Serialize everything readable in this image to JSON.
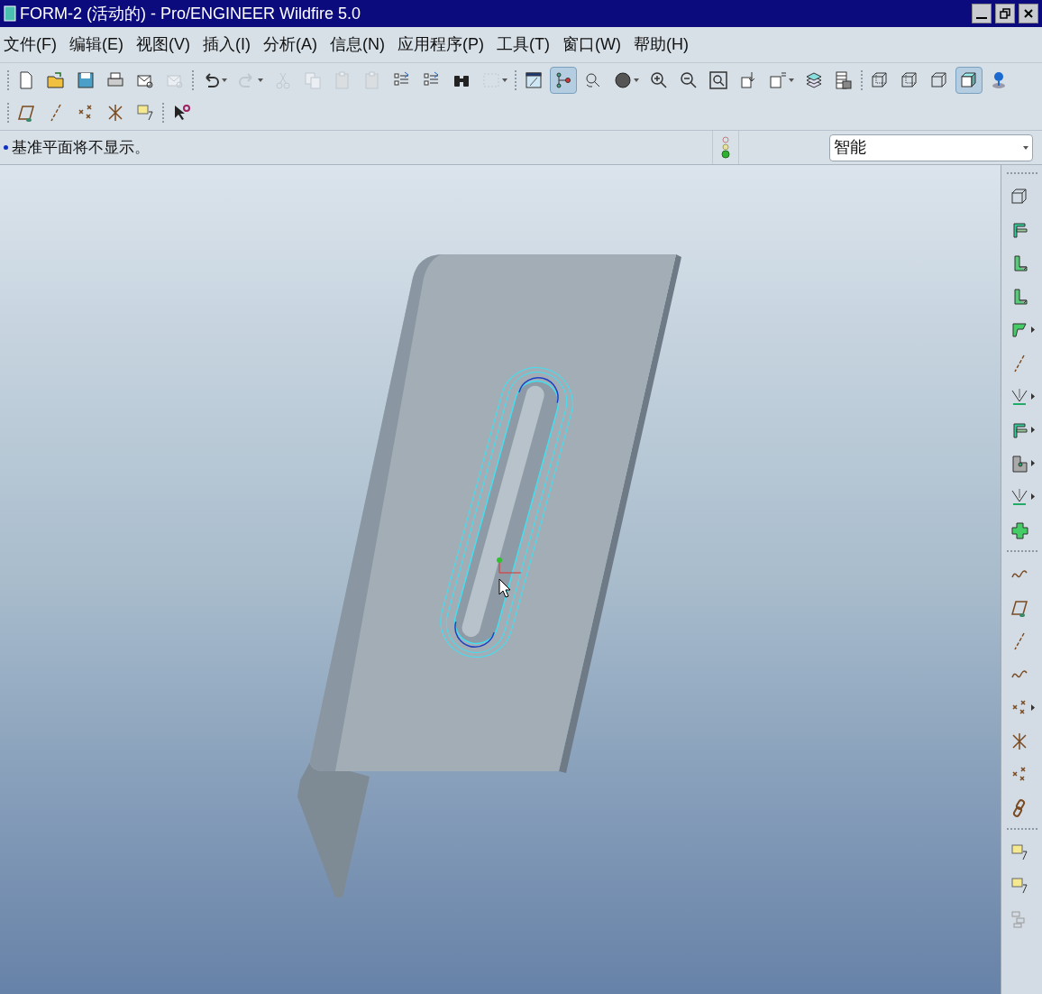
{
  "window": {
    "title": "FORM-2 (活动的) - Pro/ENGINEER Wildfire 5.0"
  },
  "menu": [
    "文件(F)",
    "编辑(E)",
    "视图(V)",
    "插入(I)",
    "分析(A)",
    "信息(N)",
    "应用程序(P)",
    "工具(T)",
    "窗口(W)",
    "帮助(H)"
  ],
  "toolbar_rows": [
    [
      [
        {
          "kind": "page",
          "selected": false,
          "disabled": false,
          "dropdown": false
        },
        {
          "kind": "folder",
          "selected": false,
          "disabled": false,
          "dropdown": false
        },
        {
          "kind": "floppy",
          "selected": false,
          "disabled": false,
          "dropdown": false
        },
        {
          "kind": "printer",
          "selected": false,
          "disabled": false,
          "dropdown": false
        },
        {
          "kind": "envelope",
          "selected": false,
          "disabled": false,
          "dropdown": false
        },
        {
          "kind": "envelope",
          "selected": false,
          "disabled": true,
          "dropdown": false
        }
      ],
      [
        {
          "kind": "undo",
          "selected": false,
          "disabled": false,
          "dropdown": true
        },
        {
          "kind": "redo",
          "selected": false,
          "disabled": true,
          "dropdown": true
        },
        {
          "kind": "scissors",
          "selected": false,
          "disabled": true,
          "dropdown": false
        },
        {
          "kind": "copy",
          "selected": false,
          "disabled": true,
          "dropdown": false
        },
        {
          "kind": "clipboard",
          "selected": false,
          "disabled": true,
          "dropdown": false
        },
        {
          "kind": "clipboard",
          "selected": false,
          "disabled": true,
          "dropdown": false
        },
        {
          "kind": "list",
          "selected": false,
          "disabled": false,
          "dropdown": false
        },
        {
          "kind": "list",
          "selected": false,
          "disabled": false,
          "dropdown": false
        },
        {
          "kind": "binoculars",
          "selected": false,
          "disabled": false,
          "dropdown": false
        },
        {
          "kind": "dashedbox",
          "selected": false,
          "disabled": true,
          "dropdown": true
        }
      ],
      [
        {
          "kind": "window",
          "selected": false,
          "disabled": false,
          "dropdown": false
        },
        {
          "kind": "nodes",
          "selected": true,
          "disabled": false,
          "dropdown": false
        },
        {
          "kind": "orient",
          "selected": false,
          "disabled": false,
          "dropdown": false
        },
        {
          "kind": "sphere",
          "selected": false,
          "disabled": false,
          "dropdown": true
        },
        {
          "kind": "zoomin",
          "selected": false,
          "disabled": false,
          "dropdown": false
        },
        {
          "kind": "zoomout",
          "selected": false,
          "disabled": false,
          "dropdown": false
        },
        {
          "kind": "zoomfit",
          "selected": false,
          "disabled": false,
          "dropdown": false
        },
        {
          "kind": "boxarrow",
          "selected": false,
          "disabled": false,
          "dropdown": false
        },
        {
          "kind": "boxlabel",
          "selected": false,
          "disabled": false,
          "dropdown": true
        },
        {
          "kind": "layers",
          "selected": false,
          "disabled": false,
          "dropdown": false
        },
        {
          "kind": "table",
          "selected": false,
          "disabled": false,
          "dropdown": false
        }
      ],
      [
        {
          "kind": "cubewire",
          "selected": false,
          "disabled": false,
          "dropdown": false
        },
        {
          "kind": "cubewire",
          "selected": false,
          "disabled": false,
          "dropdown": false
        },
        {
          "kind": "cube",
          "selected": false,
          "disabled": false,
          "dropdown": false
        },
        {
          "kind": "cubeshaded",
          "selected": true,
          "disabled": false,
          "dropdown": false
        },
        {
          "kind": "pin",
          "selected": false,
          "disabled": false,
          "dropdown": false
        }
      ]
    ],
    [
      [
        {
          "kind": "plane",
          "selected": false,
          "disabled": false,
          "dropdown": false
        },
        {
          "kind": "axis",
          "selected": false,
          "disabled": false,
          "dropdown": false
        },
        {
          "kind": "points",
          "selected": false,
          "disabled": false,
          "dropdown": false
        },
        {
          "kind": "csys",
          "selected": false,
          "disabled": false,
          "dropdown": false
        },
        {
          "kind": "note",
          "selected": false,
          "disabled": false,
          "dropdown": false
        }
      ],
      [
        {
          "kind": "help",
          "selected": false,
          "disabled": false,
          "dropdown": false
        }
      ]
    ]
  ],
  "status": {
    "message": "基准平面将不显示。",
    "filter": "智能"
  },
  "right_toolbar": [
    [
      {
        "kind": "cube",
        "dropdown": false
      },
      {
        "kind": "wall",
        "dropdown": false
      },
      {
        "kind": "flange",
        "dropdown": false
      },
      {
        "kind": "flange",
        "dropdown": false
      },
      {
        "kind": "extrude",
        "dropdown": true
      },
      {
        "kind": "axis",
        "dropdown": false
      },
      {
        "kind": "bend",
        "dropdown": true
      },
      {
        "kind": "wall",
        "dropdown": true
      },
      {
        "kind": "corner",
        "dropdown": true
      },
      {
        "kind": "bend",
        "dropdown": true
      },
      {
        "kind": "cross",
        "dropdown": false
      }
    ],
    [
      {
        "kind": "curve",
        "dropdown": false
      },
      {
        "kind": "plane",
        "dropdown": false
      },
      {
        "kind": "axis",
        "dropdown": false
      },
      {
        "kind": "curve",
        "dropdown": false
      },
      {
        "kind": "points",
        "dropdown": true
      },
      {
        "kind": "csys",
        "dropdown": false
      },
      {
        "kind": "points",
        "dropdown": false
      },
      {
        "kind": "chain",
        "dropdown": false
      }
    ],
    [
      {
        "kind": "note",
        "dropdown": false
      },
      {
        "kind": "note",
        "dropdown": false
      },
      {
        "kind": "boxes",
        "dropdown": false
      }
    ]
  ]
}
